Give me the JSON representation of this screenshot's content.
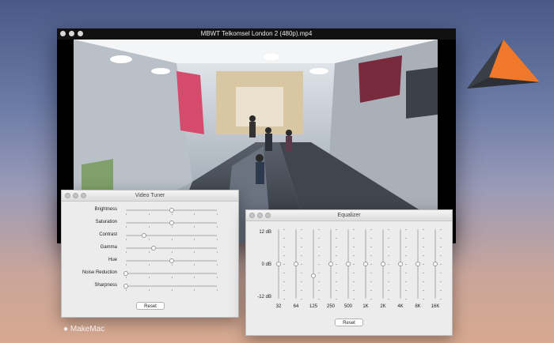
{
  "player": {
    "title": "MBWT Telkomsel London 2 (480p).mp4"
  },
  "video_tuner": {
    "title": "Video Tuner",
    "reset_label": "Reset",
    "sliders": [
      {
        "label": "Brightness",
        "value": 0.5
      },
      {
        "label": "Saturation",
        "value": 0.5
      },
      {
        "label": "Contrast",
        "value": 0.2
      },
      {
        "label": "Gamma",
        "value": 0.3
      },
      {
        "label": "Hue",
        "value": 0.5
      },
      {
        "label": "Noise Reduction",
        "value": 0.0
      },
      {
        "label": "Sharpness",
        "value": 0.0
      }
    ]
  },
  "equalizer": {
    "title": "Equalizer",
    "reset_label": "Reset",
    "db_labels": {
      "top": "12 dB",
      "mid": "0 dB",
      "bottom": "-12 dB"
    },
    "bands": [
      {
        "freq": "32",
        "value": 0.0
      },
      {
        "freq": "64",
        "value": 0.0
      },
      {
        "freq": "125",
        "value": -4.0
      },
      {
        "freq": "250",
        "value": 0.0
      },
      {
        "freq": "500",
        "value": 0.0
      },
      {
        "freq": "1K",
        "value": 0.0
      },
      {
        "freq": "2K",
        "value": 0.0
      },
      {
        "freq": "4K",
        "value": 0.0
      },
      {
        "freq": "8K",
        "value": 0.0
      },
      {
        "freq": "16K",
        "value": 0.0
      }
    ]
  },
  "watermark": "MakeMac",
  "colors": {
    "logo_orange": "#f0782a",
    "logo_dark": "#3a3f47",
    "panel_bg": "#ececec"
  }
}
